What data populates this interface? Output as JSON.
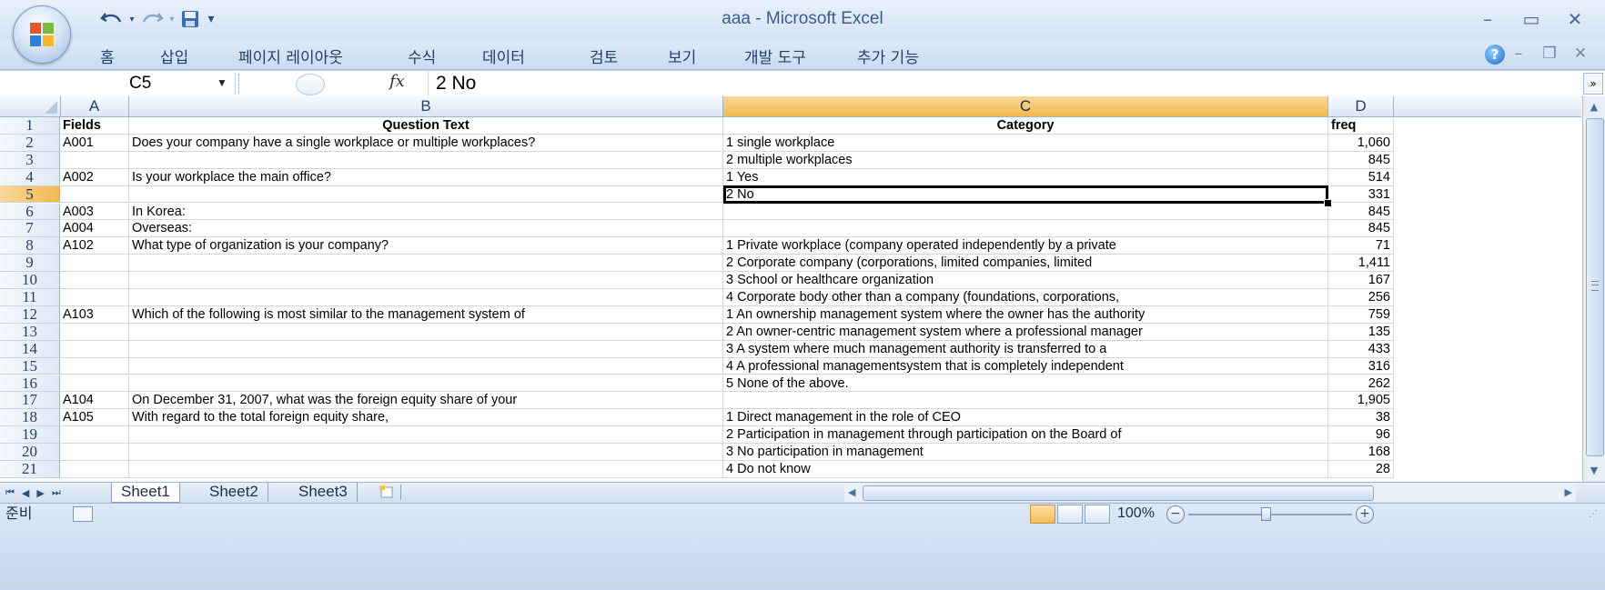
{
  "window": {
    "title": "aaa - Microsoft Excel",
    "qat": [
      "undo-icon",
      "redo-icon",
      "save-icon",
      "customize-qat-icon"
    ]
  },
  "ribbon": {
    "tabs": [
      "홈",
      "삽입",
      "페이지 레이아웃",
      "수식",
      "데이터",
      "검토",
      "보기",
      "개발 도구",
      "추가 기능"
    ]
  },
  "formula_bar": {
    "name_box": "C5",
    "fx_label": "fx",
    "value": "2 No"
  },
  "columns": [
    "A",
    "B",
    "C",
    "D"
  ],
  "rows": [
    {
      "num": "1",
      "A": "Fields",
      "B": "Question Text",
      "C": "Category",
      "D": "freq"
    },
    {
      "num": "2",
      "A": "A001",
      "B": "Does your company have a single workplace or multiple workplaces?",
      "C": "1 single workplace",
      "D": "1,060"
    },
    {
      "num": "3",
      "A": "",
      "B": "",
      "C": "2 multiple workplaces",
      "D": "845"
    },
    {
      "num": "4",
      "A": "A002",
      "B": "Is your workplace the main office?",
      "C": "1 Yes",
      "D": "514"
    },
    {
      "num": "5",
      "A": "",
      "B": "",
      "C": "2 No",
      "D": "331"
    },
    {
      "num": "6",
      "A": "A003",
      "B": "In Korea:",
      "C": "",
      "D": "845"
    },
    {
      "num": "7",
      "A": "A004",
      "B": "Overseas:",
      "C": "",
      "D": "845"
    },
    {
      "num": "8",
      "A": "A102",
      "B": "What type of organization is your company?",
      "C": "1 Private workplace (company operated independently by a private",
      "D": "71"
    },
    {
      "num": "9",
      "A": "",
      "B": "",
      "C": "2 Corporate company (corporations, limited companies, limited",
      "D": "1,411"
    },
    {
      "num": "10",
      "A": "",
      "B": "",
      "C": "3 School or healthcare organization",
      "D": "167"
    },
    {
      "num": "11",
      "A": "",
      "B": "",
      "C": "4 Corporate body other than a company (foundations, corporations,",
      "D": "256"
    },
    {
      "num": "12",
      "A": "A103",
      "B": "Which of the following is most similar to the management system of",
      "C": "1 An ownership management system where the owner has the authority",
      "D": "759"
    },
    {
      "num": "13",
      "A": "",
      "B": "",
      "C": "2 An owner-centric management system where a professional manager",
      "D": "135"
    },
    {
      "num": "14",
      "A": "",
      "B": "",
      "C": "3 A system where much management authority is transferred to a",
      "D": "433"
    },
    {
      "num": "15",
      "A": "",
      "B": "",
      "C": "4 A professional managementsystem that is completely independent",
      "D": "316"
    },
    {
      "num": "16",
      "A": "",
      "B": "",
      "C": "5 None of the above.",
      "D": "262"
    },
    {
      "num": "17",
      "A": "A104",
      "B": "On December 31, 2007, what was the foreign equity share of your",
      "C": "",
      "D": "1,905"
    },
    {
      "num": "18",
      "A": "A105",
      "B": "With regard to the total foreign equity share,",
      "C": "1 Direct management in the role of CEO",
      "D": "38"
    },
    {
      "num": "19",
      "A": "",
      "B": "",
      "C": "2 Participation in management through participation on the Board of",
      "D": "96"
    },
    {
      "num": "20",
      "A": "",
      "B": "",
      "C": "3 No participation in management",
      "D": "168"
    },
    {
      "num": "21",
      "A": "",
      "B": "",
      "C": "4 Do not know",
      "D": "28"
    }
  ],
  "active_cell": {
    "col": "C",
    "row": "5"
  },
  "sheets": [
    "Sheet1",
    "Sheet2",
    "Sheet3"
  ],
  "active_sheet": "Sheet1",
  "status": {
    "ready": "준비",
    "zoom": "100%"
  },
  "colors": {
    "selection_border": "#000000",
    "active_header": "#f1b84e",
    "frame_blue": "#c9dcf2"
  }
}
